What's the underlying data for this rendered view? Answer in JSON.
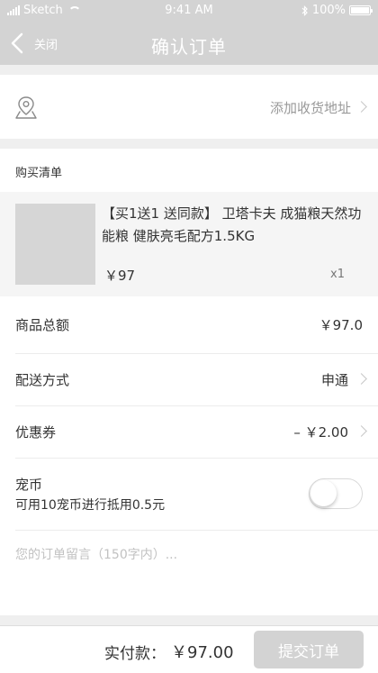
{
  "status_bar": {
    "carrier": "Sketch",
    "time": "9:41 AM",
    "battery": "100%"
  },
  "nav": {
    "back_label": "关闭",
    "title": "确认订单"
  },
  "address": {
    "add_label": "添加收货地址"
  },
  "purchase_list": {
    "title": "购买清单",
    "item": {
      "name": "【买1送1 送同款】 卫塔卡夫 成猫粮天然功能粮 健肤亮毛配方1.5KG",
      "price": "￥97",
      "quantity": "x1"
    }
  },
  "summary": {
    "goods_total_label": "商品总额",
    "goods_total_value": "￥97.0",
    "delivery_label": "配送方式",
    "delivery_value": "申通",
    "coupon_label": "优惠券",
    "coupon_value": "– ￥2.00",
    "coins_label": "宠币",
    "coins_desc": "可用10宠币进行抵用0.5元",
    "coins_enabled": false
  },
  "note": {
    "placeholder": "您的订单留言（150字内）..."
  },
  "footer": {
    "total_label": "实付款：",
    "total_value": "￥97.00",
    "submit_label": "提交订单"
  }
}
